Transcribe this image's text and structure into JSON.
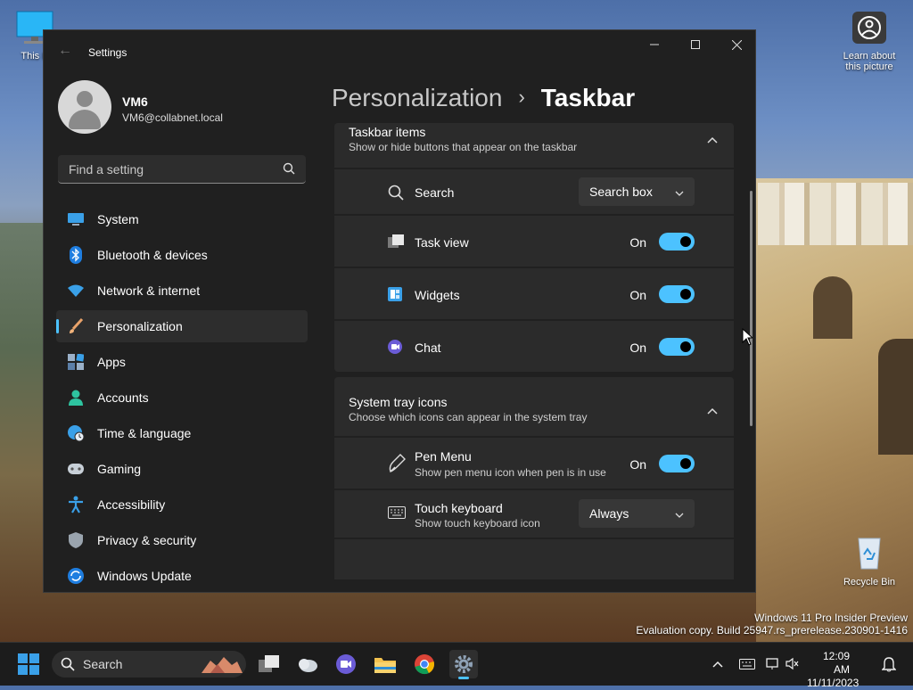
{
  "desktop": {
    "icons": [
      {
        "label": "This PC",
        "visible_label": "This P"
      },
      {
        "label": "Learn about this picture"
      },
      {
        "label": "Recycle Bin"
      }
    ],
    "watermark_line1": "Windows 11 Pro Insider Preview",
    "watermark_line2": "Evaluation copy. Build 25947.rs_prerelease.230901-1416"
  },
  "window": {
    "title": "Settings",
    "controls": {
      "minimize": "—",
      "maximize": "□",
      "close": "✕"
    }
  },
  "user": {
    "name": "VM6",
    "email": "VM6@collabnet.local"
  },
  "search": {
    "placeholder": "Find a setting"
  },
  "nav": {
    "items": [
      {
        "label": "System",
        "icon": "monitor-icon"
      },
      {
        "label": "Bluetooth & devices",
        "icon": "bluetooth-icon"
      },
      {
        "label": "Network & internet",
        "icon": "wifi-icon"
      },
      {
        "label": "Personalization",
        "icon": "brush-icon",
        "selected": true
      },
      {
        "label": "Apps",
        "icon": "apps-icon"
      },
      {
        "label": "Accounts",
        "icon": "person-icon"
      },
      {
        "label": "Time & language",
        "icon": "globe-clock-icon"
      },
      {
        "label": "Gaming",
        "icon": "controller-icon"
      },
      {
        "label": "Accessibility",
        "icon": "accessibility-icon"
      },
      {
        "label": "Privacy & security",
        "icon": "shield-icon"
      },
      {
        "label": "Windows Update",
        "icon": "update-icon"
      }
    ]
  },
  "breadcrumb": {
    "parent": "Personalization",
    "separator": "›",
    "current": "Taskbar"
  },
  "taskbar_items_section": {
    "title": "Taskbar items",
    "subtitle": "Show or hide buttons that appear on the taskbar",
    "rows": [
      {
        "label": "Search",
        "control": "dropdown",
        "value": "Search box"
      },
      {
        "label": "Task view",
        "control": "toggle",
        "value": "On",
        "state": true
      },
      {
        "label": "Widgets",
        "control": "toggle",
        "value": "On",
        "state": true
      },
      {
        "label": "Chat",
        "control": "toggle",
        "value": "On",
        "state": true
      }
    ]
  },
  "system_tray_section": {
    "title": "System tray icons",
    "subtitle": "Choose which icons can appear in the system tray",
    "rows": [
      {
        "label": "Pen Menu",
        "sub": "Show pen menu icon when pen is in use",
        "control": "toggle",
        "value": "On",
        "state": true
      },
      {
        "label": "Touch keyboard",
        "sub": "Show touch keyboard icon",
        "control": "dropdown",
        "value": "Always"
      }
    ]
  },
  "taskbar": {
    "search_label": "Search",
    "time": "12:09 AM",
    "date": "11/11/2023"
  },
  "colors": {
    "accent": "#4cc2ff",
    "window_bg": "#202020",
    "card_bg": "#2b2b2b"
  }
}
